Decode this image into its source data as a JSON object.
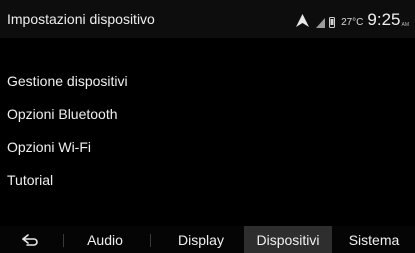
{
  "header": {
    "title": "Impostazioni dispositivo",
    "temperature": "27°C",
    "time": "9:25",
    "ampm": "AM"
  },
  "menu": {
    "items": [
      {
        "label": "Gestione dispositivi"
      },
      {
        "label": "Opzioni Bluetooth"
      },
      {
        "label": "Opzioni Wi-Fi"
      },
      {
        "label": "Tutorial"
      }
    ]
  },
  "tabs": {
    "back_icon": "back-arrow-icon",
    "items": [
      {
        "label": "Audio",
        "active": false
      },
      {
        "label": "Display",
        "active": false
      },
      {
        "label": "Dispositivi",
        "active": true
      },
      {
        "label": "Sistema",
        "active": false
      }
    ]
  },
  "colors": {
    "background": "#000000",
    "text": "#f0f0f0",
    "active_tab": "#2e2e2e"
  }
}
